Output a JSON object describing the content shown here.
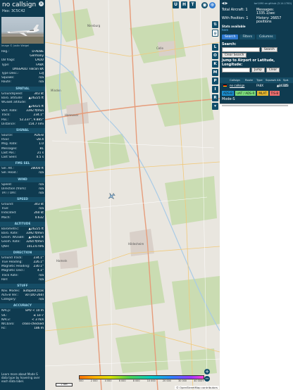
{
  "infobox": {
    "callsign": "no callsign",
    "hex_label": "Hex:",
    "hex": "3C5C42",
    "photo_credit": "Image © Justin Weigel",
    "rows_top": [
      {
        "k": "Reg.:",
        "v": "D-ADBE"
      },
      {
        "k": "",
        "v": "Germany"
      },
      {
        "k": "DB flags:",
        "v": "LADD"
      },
      {
        "k": "Type:",
        "v": "FA8X"
      },
      {
        "k": "",
        "v": "DASSAULT Falcon 8X"
      },
      {
        "k": "Type Desc.:",
        "v": "L3J"
      },
      {
        "k": "Squawk:",
        "v": "n/a"
      },
      {
        "k": "Route:",
        "v": "n/a"
      }
    ],
    "sections": [
      {
        "title": "SPATIAL",
        "rows": [
          {
            "k": "Groundspeed:",
            "v": "343 kt"
          },
          {
            "k": "Baro. altitude:",
            "v": "▲26225 ft"
          },
          {
            "k": "WGS84 altitude:",
            "v": ""
          },
          {
            "k": "",
            "v": "▲26425 ft"
          },
          {
            "k": "Vert. Rate:",
            "v": "3392 ft/min"
          },
          {
            "k": "Track:",
            "v": "234.1°"
          },
          {
            "k": "Pos.:",
            "v": "52.237°, 9.885°"
          },
          {
            "k": "Distance:",
            "v": "154.7 nmi"
          }
        ]
      },
      {
        "title": "SIGNAL",
        "rows": [
          {
            "k": "Source:",
            "v": "ADS-B"
          },
          {
            "k": "RSSI:",
            "v": "-28.4"
          },
          {
            "k": "Msg. Rate:",
            "v": "1.0"
          },
          {
            "k": "Messages:",
            "v": "81"
          },
          {
            "k": "Last Pos.:",
            "v": "21 s"
          },
          {
            "k": "Last Seen:",
            "v": "4.5 s"
          }
        ]
      },
      {
        "title": "FMS SEL",
        "rows": [
          {
            "k": "Sel. Alt.:",
            "v": "28000 ft"
          },
          {
            "k": "Sel. Head.:",
            "v": "n/a"
          }
        ]
      },
      {
        "title": "WIND",
        "rows": [
          {
            "k": "Speed:",
            "v": "n/a"
          },
          {
            "k": "Direction (from):",
            "v": "n/a"
          },
          {
            "k": "TAT / OAT:",
            "v": "n/a"
          }
        ]
      },
      {
        "title": "SPEED",
        "rows": [
          {
            "k": "Ground:",
            "v": "343 kt"
          },
          {
            "k": "True:",
            "v": "n/a"
          },
          {
            "k": "Indicated:",
            "v": "260 kt"
          },
          {
            "k": "Mach:",
            "v": "0.632"
          }
        ]
      },
      {
        "title": "ALTITUDE",
        "rows": [
          {
            "k": "Barometric:",
            "v": "▲26225 ft"
          },
          {
            "k": "Baro. Rate:",
            "v": "3392 ft/min"
          },
          {
            "k": "Geom. WGS84:",
            "v": "▲26425 ft"
          },
          {
            "k": "Geom. Rate:",
            "v": "3264 ft/min"
          },
          {
            "k": "QNH:",
            "v": "1013.6 hPa"
          }
        ]
      },
      {
        "title": "DIRECTION",
        "rows": [
          {
            "k": "Ground Track:",
            "v": "234.1°"
          },
          {
            "k": "True Heading:",
            "v": "226.1°"
          },
          {
            "k": "Magnetic Heading:",
            "v": "230.1°"
          },
          {
            "k": "Magnetic Decl.:",
            "v": "4.1°"
          },
          {
            "k": "Track Rate:",
            "v": "n/a"
          },
          {
            "k": "Roll:",
            "v": "n/a"
          }
        ]
      },
      {
        "title": "STUFF",
        "rows": [
          {
            "k": "Nav. Modes:",
            "v": "autopilot,tcas"
          },
          {
            "k": "ADS-B Ver.:",
            "v": "v0 (DO-260)"
          },
          {
            "k": "Category:",
            "v": "n/a"
          }
        ]
      },
      {
        "title": "ACCURACY",
        "rows": [
          {
            "k": "NACp:",
            "v": "EPU < 10 m"
          },
          {
            "k": "SIL:",
            "v": "≤ 1e-7"
          },
          {
            "k": "NACv:",
            "v": "< 3 m/s"
          },
          {
            "k": "NICbaro:",
            "v": "cross-checked"
          },
          {
            "k": "Rc:",
            "v": "186 m"
          }
        ]
      }
    ],
    "footer": "Learn more about Mode S data type by hovering over each data label."
  },
  "map": {
    "top_buttons": [
      "U",
      "H",
      "T"
    ],
    "left_buttons": [
      "L",
      "O",
      "K",
      "M",
      "P",
      "I",
      "R"
    ],
    "scale_label": "2 NM",
    "zoom_in": "+",
    "zoom_out": "−",
    "attribution": "© OpenStreetMap contributors",
    "altitude_ticks": [
      "500",
      "2 000",
      "4 000",
      "6 000",
      "8 000",
      "10 000",
      "20 000",
      "30 000",
      "40 000+"
    ],
    "places": [
      "Nienburg",
      "Hannover",
      "Hildesheim",
      "Hameln",
      "Minden",
      "Celle"
    ]
  },
  "sidebar": {
    "version": "tar1090 on github (3.14.1700)",
    "stats": {
      "total_label": "Total Aircraft:",
      "total": "1",
      "messages_label": "Messages:",
      "messages": "1335.1/sec",
      "with_pos_label": "With Position:",
      "with_pos": "1",
      "history_label": "History:",
      "history": "26657 positions"
    },
    "stats_link": "Stats available",
    "stats_link2": "here",
    "tabs": [
      "Search",
      "Filters",
      "Columns"
    ],
    "search_label": "Search:",
    "search_placeholder": "",
    "search_button": "Search",
    "clear_search": "Clear Search",
    "jump_label": "Jump to Airport or Latitude, Longitude:",
    "jump_button": "Jump",
    "clear_button": "Clear",
    "columns": [
      "",
      "Callsign",
      "Route",
      "Type",
      "Squawk",
      "Alt. (ft)",
      "Spd."
    ],
    "row": [
      "",
      "no callsign",
      "",
      "FA8X",
      "",
      "▲26225",
      "343"
    ],
    "chips": [
      {
        "label": "ADS-B",
        "color": "#1b8ecf"
      },
      {
        "label": "UAT / ADS-R",
        "color": "#7de07d"
      },
      {
        "label": "MLAT",
        "color": "#e8b830"
      },
      {
        "label": "TIS-B",
        "color": "#f07070"
      }
    ],
    "modes_label": "Mode-S"
  },
  "colors": {
    "panel": "#0f3b50",
    "accent": "#2f79d0",
    "map_bg": "#e9e6df"
  }
}
